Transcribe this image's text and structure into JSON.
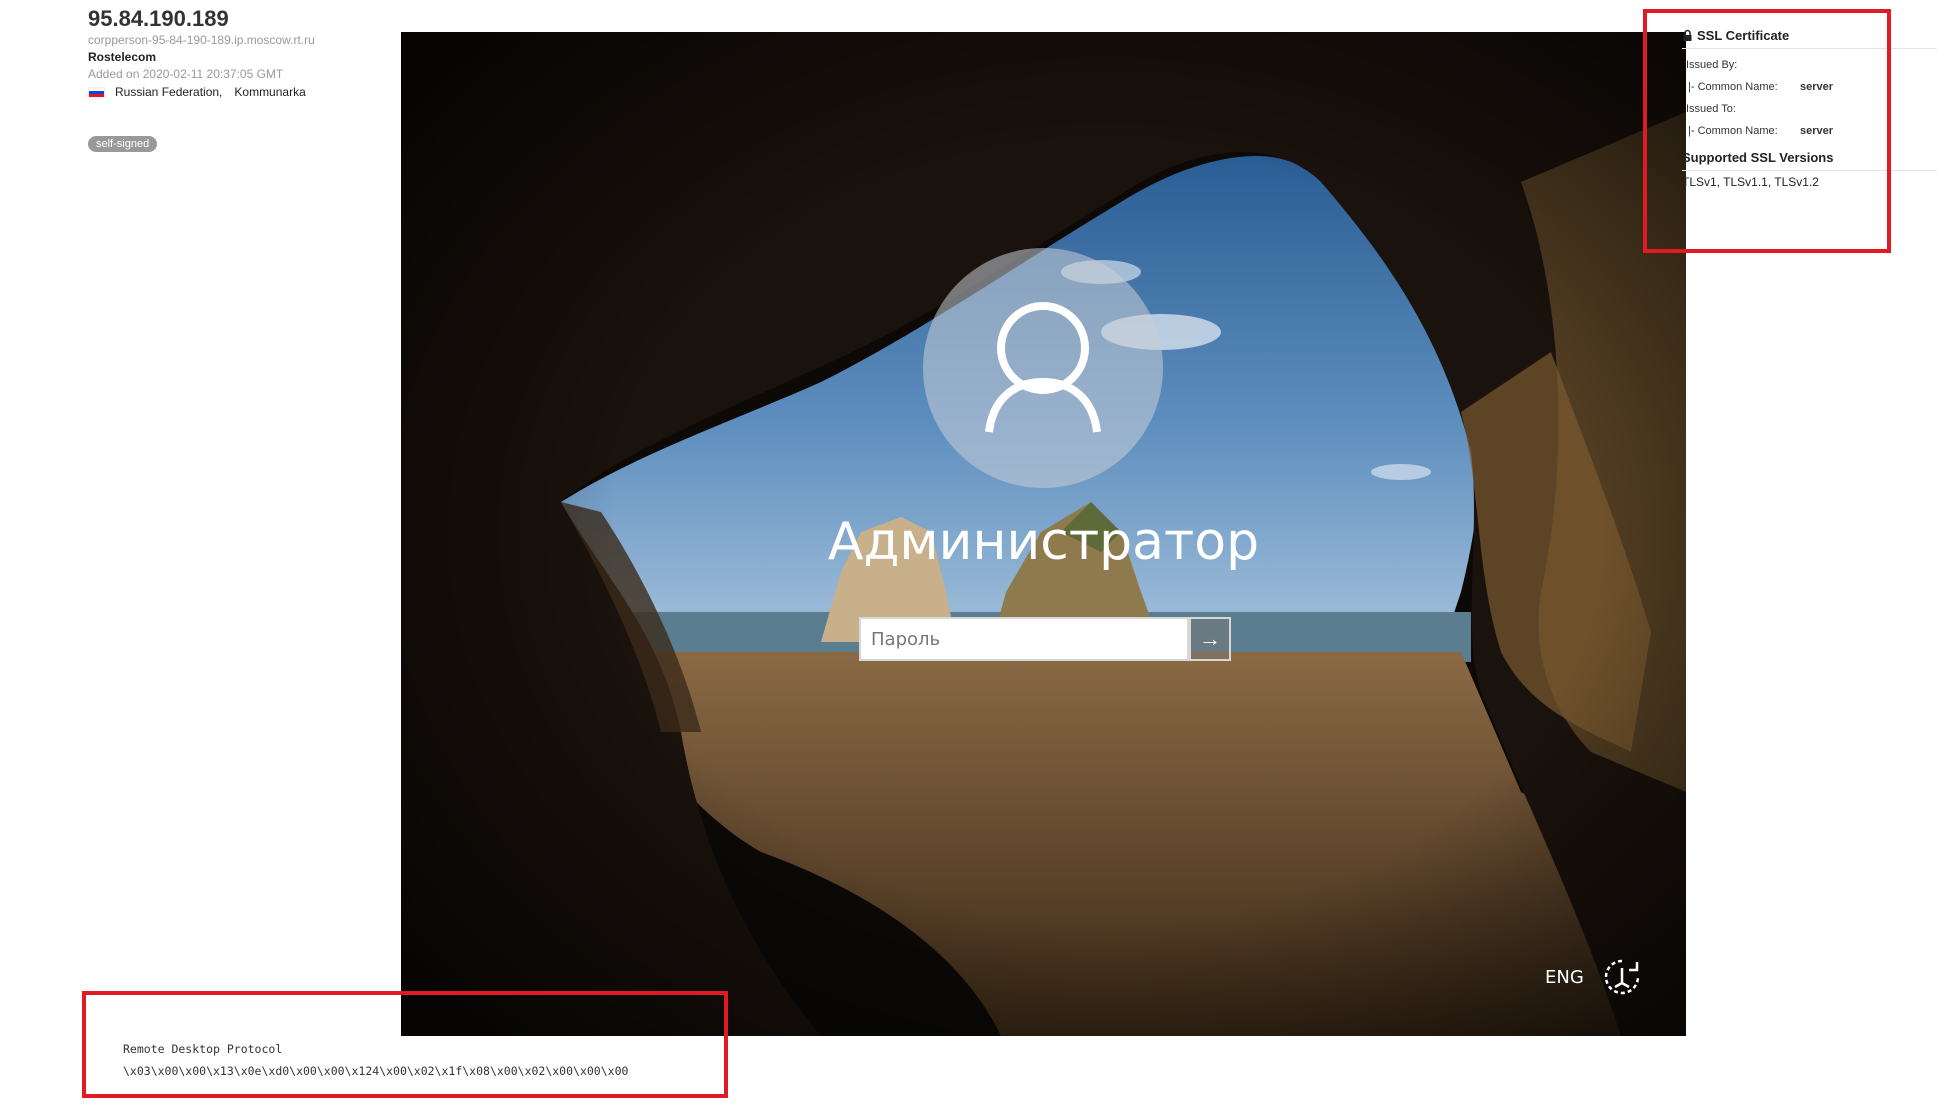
{
  "host": {
    "ip": "95.84.190.189",
    "hostname": "corpperson-95-84-190-189.ip.moscow.rt.ru",
    "org": "Rostelecom",
    "added": "Added on 2020-02-11 20:37:05 GMT",
    "country": "Russian Federation,",
    "city": "Kommunarka",
    "tag": "self-signed"
  },
  "login_screen": {
    "username": "Администратор",
    "password_placeholder": "Пароль",
    "submit_icon": "arrow-right-icon",
    "language": "ENG",
    "accessibility_icon": "ease-of-access-icon"
  },
  "ssl": {
    "title": "SSL Certificate",
    "issued_by_label": "Issued By:",
    "issued_by_cn_label": "|- Common Name:",
    "issued_by_cn_value": "server",
    "issued_to_label": "Issued To:",
    "issued_to_cn_label": "|- Common Name:",
    "issued_to_cn_value": "server",
    "versions_title": "Supported SSL Versions",
    "versions": "TLSv1, TLSv1.1, TLSv1.2"
  },
  "rdp": {
    "protocol": "Remote Desktop Protocol",
    "banner": "\\x03\\x00\\x00\\x13\\x0e\\xd0\\x00\\x00\\x124\\x00\\x02\\x1f\\x08\\x00\\x02\\x00\\x00\\x00"
  },
  "colors": {
    "highlight": "#e01b24",
    "tag_bg": "#999999"
  }
}
